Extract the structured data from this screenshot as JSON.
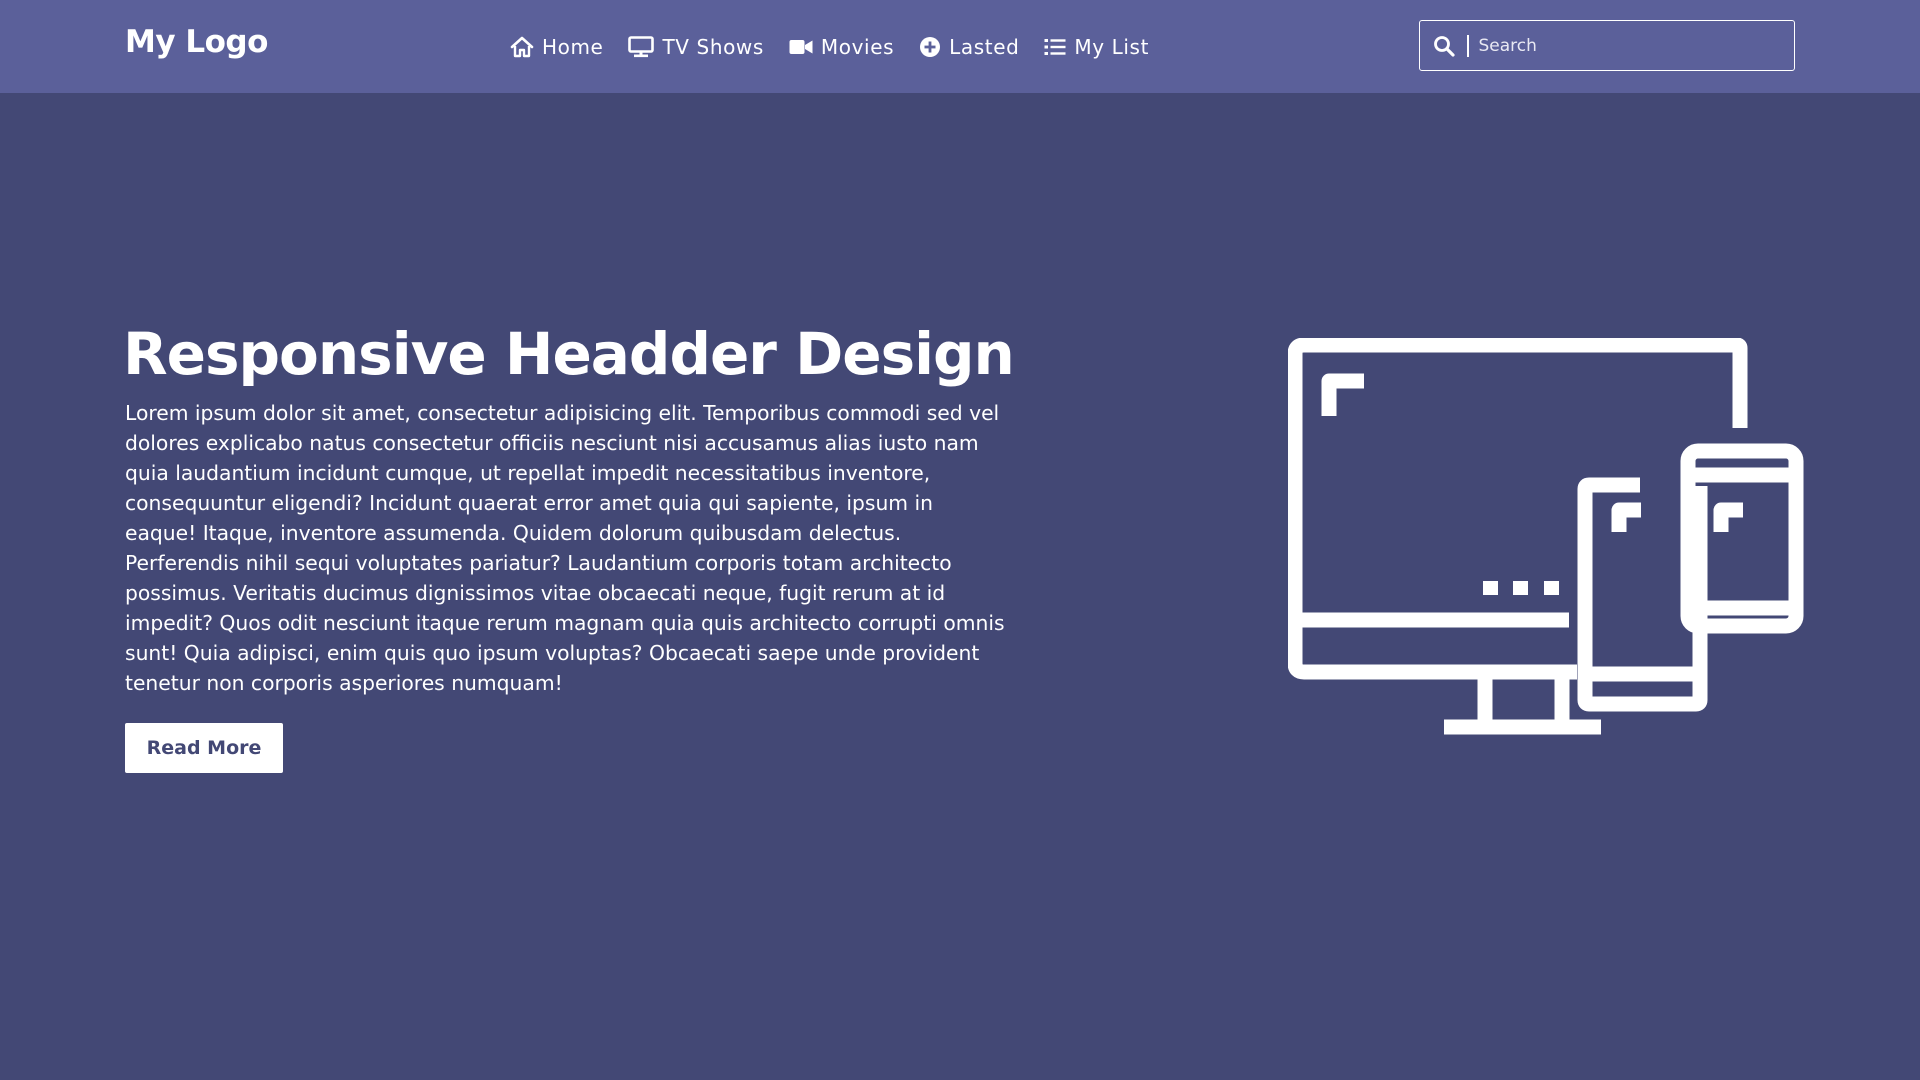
{
  "header": {
    "logo": "My Logo",
    "nav": [
      {
        "label": "Home",
        "icon": "home-icon"
      },
      {
        "label": "TV Shows",
        "icon": "tv-icon"
      },
      {
        "label": "Movies",
        "icon": "video-camera-icon"
      },
      {
        "label": "Lasted",
        "icon": "plus-circle-icon"
      },
      {
        "label": "My List",
        "icon": "list-icon"
      }
    ],
    "search": {
      "placeholder": "Search",
      "value": "",
      "icon": "search-icon"
    }
  },
  "hero": {
    "title": "Responsive Headder Design",
    "text": "Lorem ipsum dolor sit amet, consectetur adipisicing elit. Temporibus commodi sed vel dolores explicabo natus consectetur officiis nesciunt nisi accusamus alias iusto nam quia laudantium incidunt cumque, ut repellat impedit necessitatibus inventore, consequuntur eligendi? Incidunt quaerat error amet quia qui sapiente, ipsum in eaque! Itaque, inventore assumenda. Quidem dolorum quibusdam delectus. Perferendis nihil sequi voluptates pariatur? Laudantium corporis totam architecto possimus. Veritatis ducimus dignissimos vitae obcaecati neque, fugit rerum at id impedit? Quos odit nesciunt itaque rerum magnam quia quis architecto corrupti omnis sunt! Quia adipisci, enim quis quo ipsum voluptas? Obcaecati saepe unde provident tenetur non corporis asperiores numquam!",
    "button": "Read More",
    "illustration": "responsive-devices-icon"
  },
  "colors": {
    "header_bg": "#5b609a",
    "page_bg": "#434875",
    "text": "#ffffff",
    "button_text": "#434875"
  }
}
